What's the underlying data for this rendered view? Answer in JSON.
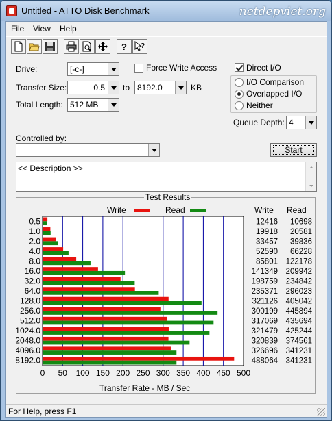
{
  "window": {
    "title": "Untitled - ATTO Disk Benchmark",
    "watermark": "netdepviet.org"
  },
  "menu": {
    "file": "File",
    "view": "View",
    "help": "Help"
  },
  "toolbar": {
    "icons": [
      "new-document-icon",
      "open-folder-icon",
      "save-icon",
      "print-icon",
      "print-preview-icon",
      "move-cursor-icon",
      "help-icon",
      "context-help-icon"
    ]
  },
  "settings": {
    "drive_label": "Drive:",
    "drive_value": "[-c-]",
    "transfer_size_label": "Transfer Size:",
    "transfer_size_from": "0.5",
    "to_label": "to",
    "transfer_size_to": "8192.0",
    "kb_label": "KB",
    "total_length_label": "Total Length:",
    "total_length_value": "512 MB",
    "force_write_label": "Force Write Access",
    "force_write_checked": false,
    "direct_io_label": "Direct I/O",
    "direct_io_checked": true,
    "io_comparison_label": "I/O Comparison",
    "overlapped_io_label": "Overlapped I/O",
    "neither_label": "Neither",
    "selected_io_mode": "Overlapped I/O",
    "queue_depth_label": "Queue Depth:",
    "queue_depth_value": "4"
  },
  "controls": {
    "controlled_by_label": "Controlled by:",
    "controlled_by_value": "",
    "start_button": "Start",
    "description": "<< Description >>"
  },
  "results": {
    "title": "Test Results",
    "legend_write": "Write",
    "legend_read": "Read",
    "col_write": "Write",
    "col_read": "Read",
    "write_color": "#e8130f",
    "read_color": "#138a13",
    "grid_color": "#0000a0"
  },
  "chart_data": {
    "type": "bar",
    "orientation": "horizontal",
    "title": "Test Results",
    "xlabel": "Transfer Rate - MB / Sec",
    "ylabel": "",
    "xlim": [
      0,
      500
    ],
    "x_ticks": [
      "0",
      "50",
      "100",
      "150",
      "200",
      "250",
      "300",
      "350",
      "400",
      "450",
      "500"
    ],
    "categories": [
      "0.5",
      "1.0",
      "2.0",
      "4.0",
      "8.0",
      "16.0",
      "32.0",
      "64.0",
      "128.0",
      "256.0",
      "512.0",
      "1024.0",
      "2048.0",
      "4096.0",
      "8192.0"
    ],
    "series": [
      {
        "name": "Write",
        "values": [
          12416,
          19918,
          33457,
          52590,
          85801,
          141349,
          198759,
          235371,
          321126,
          300199,
          317069,
          321479,
          320839,
          326696,
          488064
        ]
      },
      {
        "name": "Read",
        "values": [
          10698,
          20581,
          39836,
          66228,
          122178,
          209942,
          234842,
          296023,
          405042,
          445894,
          435694,
          425244,
          374561,
          341231,
          341231
        ]
      }
    ],
    "value_scale_note_units": "KB/s",
    "grid": true,
    "legend": "top"
  },
  "statusbar": {
    "text": "For Help, press F1"
  }
}
